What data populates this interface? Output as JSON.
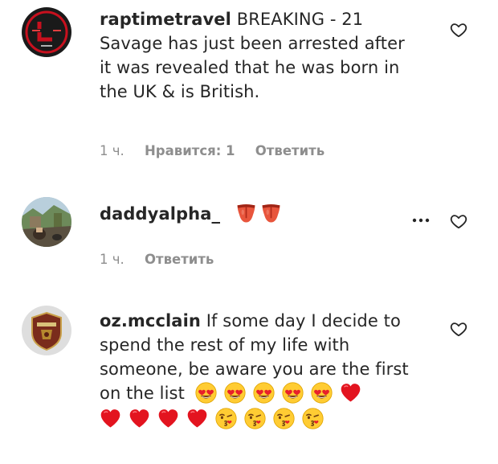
{
  "comments": [
    {
      "username": "raptimetravel",
      "text": "BREAKING - 21 Savage has just been arrested after it was revealed that he was born in the UK & is British.",
      "time": "1 ч.",
      "likes": "Нравится: 1",
      "reply": "Ответить"
    },
    {
      "username": "daddyalpha_",
      "text": "",
      "emojis": [
        "tongue-emoji",
        "tongue-emoji"
      ],
      "time": "1 ч.",
      "reply": "Ответить"
    },
    {
      "username": "oz.mcclain",
      "text": "If some day I decide to spend the rest of my life with someone, be aware you are the first on the list",
      "emojis_line1": [
        "heart-eyes-emoji",
        "heart-eyes-emoji",
        "heart-eyes-emoji",
        "heart-eyes-emoji",
        "heart-eyes-emoji",
        "red-heart-emoji"
      ],
      "emojis_line2": [
        "red-heart-emoji",
        "red-heart-emoji",
        "red-heart-emoji",
        "red-heart-emoji",
        "kiss-wink-emoji",
        "kiss-wink-emoji",
        "kiss-wink-emoji",
        "kiss-wink-emoji"
      ]
    }
  ],
  "colors": {
    "text": "#262626",
    "meta": "#8e8e8e",
    "heart_outline": "#262626"
  },
  "icons": [
    "heart-outline-icon",
    "more-options-icon"
  ]
}
